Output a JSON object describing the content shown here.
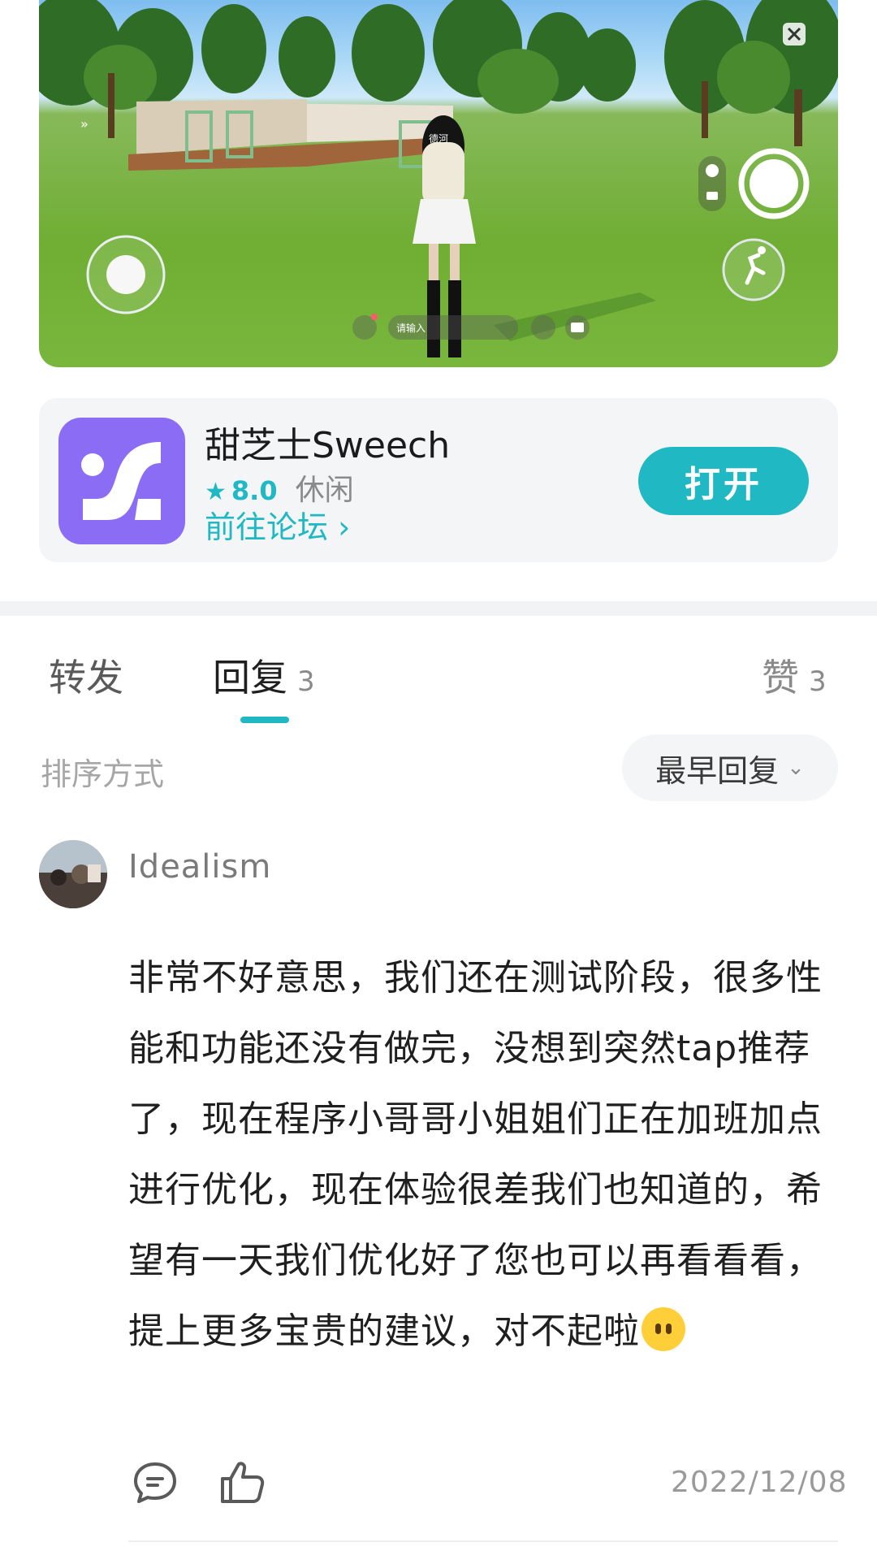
{
  "game_screenshot": {
    "chat_placeholder": "请输入",
    "tag": "德河",
    "close_icon": "close-icon",
    "camera_icon": "camera-icon",
    "video_icon": "video-icon",
    "run_icon": "run-icon",
    "chat_icon": "chat-bubble-icon",
    "mail_icon": "mail-icon",
    "expand_arrow": "»"
  },
  "app": {
    "name": "甜芝士Sweech",
    "rating": "8.0",
    "category": "休闲",
    "forum_link": "前往论坛 ›",
    "open_button": "打开",
    "accent_color": "#1fb8c3",
    "icon_color": "#8b6cf5"
  },
  "tabs": [
    {
      "label": "转发",
      "count": ""
    },
    {
      "label": "回复",
      "count": "3"
    },
    {
      "label": "赞",
      "count": "3"
    }
  ],
  "sort": {
    "label": "排序方式",
    "selected": "最早回复",
    "chevron": "⌄"
  },
  "comment": {
    "username": "Idealism",
    "text": "非常不好意思，我们还在测试阶段，很多性能和功能还没有做完，没想到突然tap推荐了，现在程序小哥哥小姐姐们正在加班加点进行优化，现在体验很差我们也知道的，希望有一天我们优化好了您也可以再看看看，提上更多宝贵的建议，对不起啦",
    "date": "2022/12/08"
  }
}
